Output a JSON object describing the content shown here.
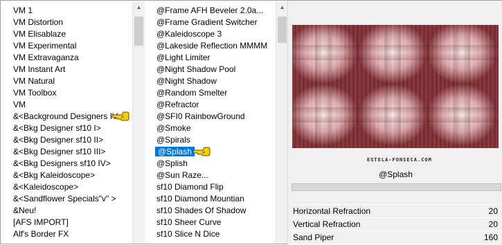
{
  "categories": {
    "items": [
      {
        "label": "VM 1",
        "pointer": false
      },
      {
        "label": "VM Distortion",
        "pointer": false
      },
      {
        "label": "VM Elisablaze",
        "pointer": false
      },
      {
        "label": "VM Experimental",
        "pointer": false
      },
      {
        "label": "VM Extravaganza",
        "pointer": false
      },
      {
        "label": "VM Instant Art",
        "pointer": false
      },
      {
        "label": "VM Natural",
        "pointer": false
      },
      {
        "label": "VM Toolbox",
        "pointer": false
      },
      {
        "label": "VM",
        "pointer": false
      },
      {
        "label": "&<Background Designers IV>",
        "pointer": true
      },
      {
        "label": "&<Bkg Designer sf10 I>",
        "pointer": false
      },
      {
        "label": "&<Bkg Designer sf10 II>",
        "pointer": false
      },
      {
        "label": "&<Bkg Designer sf10 III>",
        "pointer": false
      },
      {
        "label": "&<Bkg Designers sf10 IV>",
        "pointer": false
      },
      {
        "label": "&<Bkg Kaleidoscope>",
        "pointer": false
      },
      {
        "label": "&<Kaleidoscope>",
        "pointer": false
      },
      {
        "label": "&<Sandflower Specials\"v\" >",
        "pointer": false
      },
      {
        "label": "&Neu!",
        "pointer": false
      },
      {
        "label": "[AFS IMPORT]",
        "pointer": false
      },
      {
        "label": "Alf's Border FX",
        "pointer": false
      }
    ]
  },
  "filters": {
    "selected": "@Splash",
    "items": [
      {
        "label": "@Frame AFH Beveler 2.0a...",
        "selected": false
      },
      {
        "label": "@Frame Gradient Switcher",
        "selected": false
      },
      {
        "label": "@Kaleidoscope 3",
        "selected": false
      },
      {
        "label": "@Lakeside Reflection MMMM",
        "selected": false
      },
      {
        "label": "@Light Limiter",
        "selected": false
      },
      {
        "label": "@Night Shadow Pool",
        "selected": false
      },
      {
        "label": "@Night Shadow",
        "selected": false
      },
      {
        "label": "@Random Smelter",
        "selected": false
      },
      {
        "label": "@Refractor",
        "selected": false
      },
      {
        "label": "@SFI0 RainbowGround",
        "selected": false
      },
      {
        "label": "@Smoke",
        "selected": false
      },
      {
        "label": "@Spirals",
        "selected": false
      },
      {
        "label": "@Splash",
        "selected": true
      },
      {
        "label": "@Splish",
        "selected": false
      },
      {
        "label": "@Sun Raze...",
        "selected": false
      },
      {
        "label": "sf10 Diamond Flip",
        "selected": false
      },
      {
        "label": "sf10 Diamond Mountian",
        "selected": false
      },
      {
        "label": "sf10 Shades Of Shadow",
        "selected": false
      },
      {
        "label": "sf10 Sheer Curve",
        "selected": false
      },
      {
        "label": "sf10 Slice N Dice",
        "selected": false
      }
    ]
  },
  "preview": {
    "watermark": "ESTELA-FONSECA.COM",
    "filter_name": "@Splash",
    "colors": {
      "light": "#f2d6d8",
      "mid": "#c4868c",
      "dark": "#4a1216"
    }
  },
  "params": [
    {
      "name": "Horizontal Refraction",
      "value": "20"
    },
    {
      "name": "Vertical Refraction",
      "value": "20"
    },
    {
      "name": "Sand Piper",
      "value": "160"
    }
  ],
  "icons": {
    "pointer": "pointing-hand-icon",
    "scroll_up": "scroll-up-arrow-icon"
  }
}
